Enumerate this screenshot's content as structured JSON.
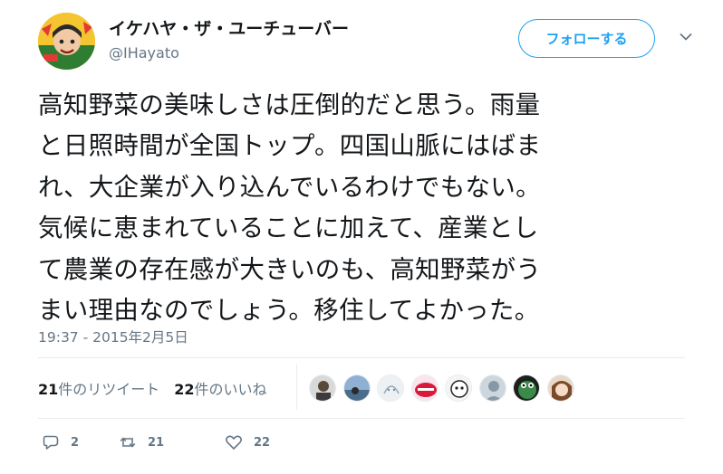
{
  "author": {
    "name": "イケハヤ・ザ・ユーチューバー",
    "handle": "@IHayato"
  },
  "follow_button_label": "フォローする",
  "tweet": {
    "lines": [
      "高知野菜の美味しさは圧倒的だと思う。雨量",
      "と日照時間が全国トップ。四国山脈にはばま",
      "れ、大企業が入り込んでいるわけでもない。",
      "気候に恵まれていることに加えて、産業とし",
      "て農業の存在感が大きいのも、高知野菜がう",
      "まい理由なのでしょう。移住してよかった。"
    ],
    "timestamp": "19:37 - 2015年2月5日"
  },
  "stats": {
    "retweets": {
      "count": "21",
      "label": "件のリツイート"
    },
    "likes": {
      "count": "22",
      "label": "件のいいね"
    }
  },
  "likers": [
    {
      "icon": "liker-avatar-1",
      "bg": "#d9d9d9"
    },
    {
      "icon": "liker-avatar-2",
      "bg": "#6b8fb5"
    },
    {
      "icon": "liker-avatar-3",
      "bg": "#e9ecee"
    },
    {
      "icon": "liker-avatar-4",
      "bg": "#d81b3a"
    },
    {
      "icon": "liker-avatar-5",
      "bg": "#f4f4f4"
    },
    {
      "icon": "liker-avatar-6",
      "bg": "#ccd6dd"
    },
    {
      "icon": "liker-avatar-7",
      "bg": "#3a8a4a"
    },
    {
      "icon": "liker-avatar-8",
      "bg": "#c9a27a"
    }
  ],
  "actions": {
    "reply": {
      "icon": "reply-icon",
      "count": "2"
    },
    "retweet": {
      "icon": "retweet-icon",
      "count": "21"
    },
    "like": {
      "icon": "heart-icon",
      "count": "22"
    }
  },
  "colors": {
    "accent": "#1da1f2",
    "text": "#14171a",
    "secondary": "#657786",
    "divider": "#e6ecf0"
  }
}
